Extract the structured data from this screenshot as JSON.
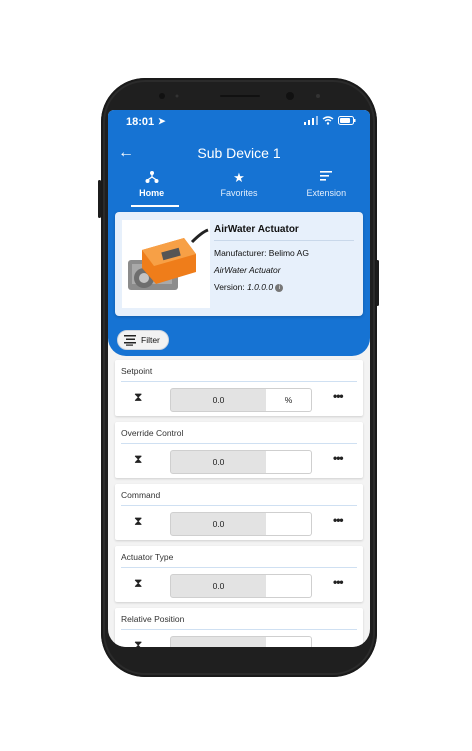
{
  "status_bar": {
    "time": "18:01"
  },
  "header": {
    "title": "Sub Device 1",
    "back_icon": "arrow-left-icon"
  },
  "tabs": [
    {
      "label": "Home",
      "icon": "device-tree-icon",
      "active": true
    },
    {
      "label": "Favorites",
      "icon": "star-icon",
      "active": false
    },
    {
      "label": "Extension",
      "icon": "lines-icon",
      "active": false
    }
  ],
  "device": {
    "name": "AirWater Actuator",
    "manufacturer": "Manufacturer: Belimo AG",
    "model": "AirWater Actuator",
    "version_label": "Version:",
    "version": "1.0.0.0"
  },
  "filter": {
    "label": "Filter"
  },
  "datapoints": [
    {
      "label": "Setpoint",
      "value": "0.0",
      "unit": "%"
    },
    {
      "label": "Override Control",
      "value": "0.0",
      "unit": ""
    },
    {
      "label": "Command",
      "value": "0.0",
      "unit": ""
    },
    {
      "label": "Actuator Type",
      "value": "0.0",
      "unit": ""
    },
    {
      "label": "Relative Position",
      "value": "",
      "unit": ""
    }
  ],
  "colors": {
    "primary": "#1673d3",
    "card_bg": "#e7f0fb"
  }
}
